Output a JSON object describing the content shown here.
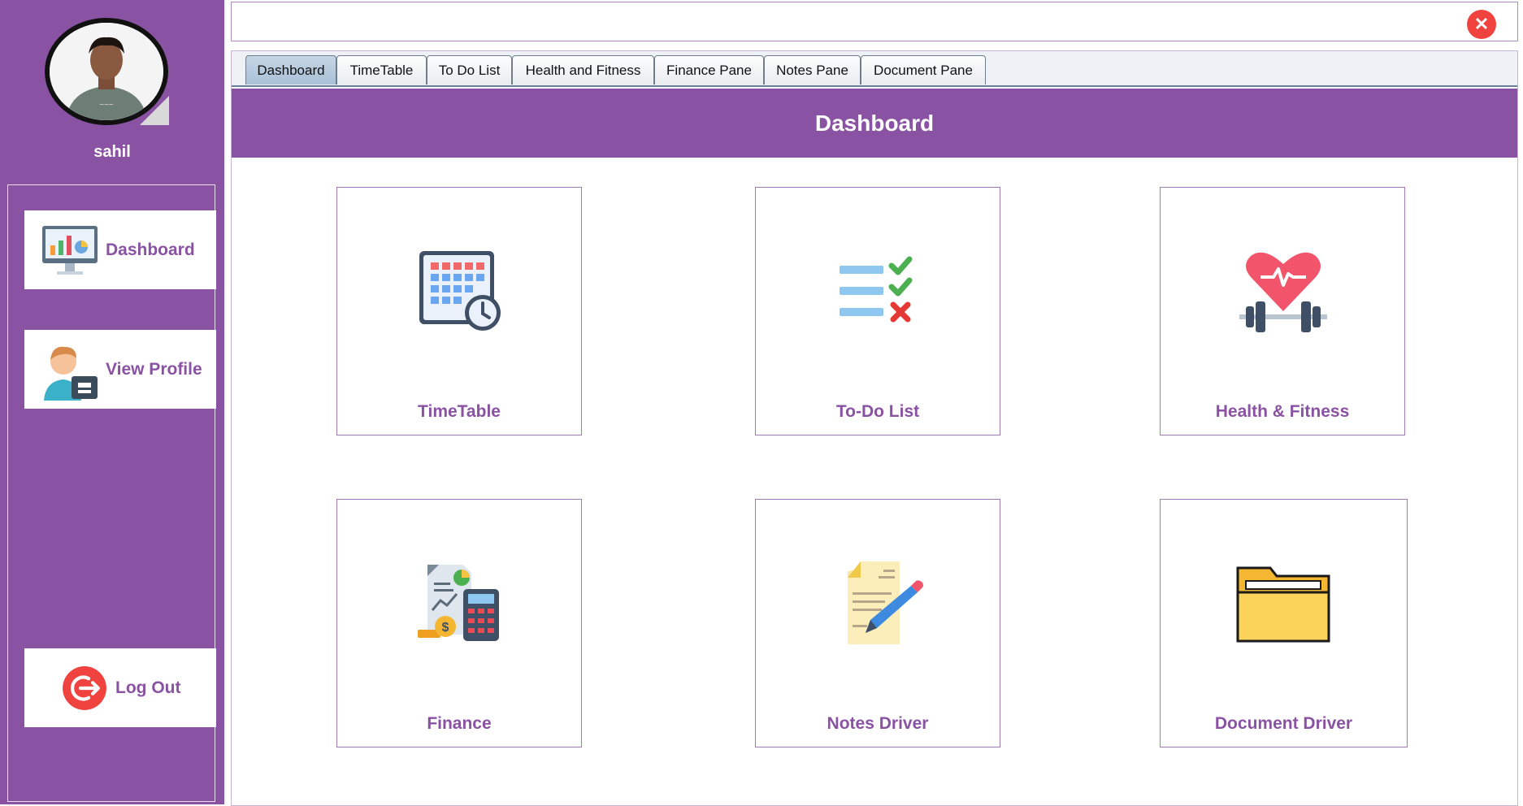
{
  "user": {
    "name": "sahil"
  },
  "sidebar": {
    "items": [
      {
        "label": "Dashboard",
        "icon": "monitor-chart-icon"
      },
      {
        "label": "View Profile",
        "icon": "user-profile-icon"
      },
      {
        "label": "Log Out",
        "icon": "logout-icon"
      }
    ]
  },
  "topbar": {
    "close_icon": "close-icon"
  },
  "tabs": [
    {
      "label": "Dashboard",
      "active": true
    },
    {
      "label": "TimeTable"
    },
    {
      "label": "To Do List"
    },
    {
      "label": "Health and Fitness"
    },
    {
      "label": "Finance Pane"
    },
    {
      "label": "Notes Pane"
    },
    {
      "label": "Document Pane"
    }
  ],
  "main": {
    "title": "Dashboard",
    "cards": [
      {
        "label": "TimeTable",
        "icon": "calendar-clock-icon"
      },
      {
        "label": "To-Do List",
        "icon": "checklist-icon"
      },
      {
        "label": "Health & Fitness",
        "icon": "heart-dumbbell-icon"
      },
      {
        "label": "Finance",
        "icon": "finance-calculator-icon"
      },
      {
        "label": "Notes Driver",
        "icon": "notes-pencil-icon"
      },
      {
        "label": "Document Driver",
        "icon": "folder-icon"
      }
    ]
  },
  "colors": {
    "brand": "#8a52a3",
    "close": "#f0433f",
    "tab_active": "#a9c0d6"
  }
}
